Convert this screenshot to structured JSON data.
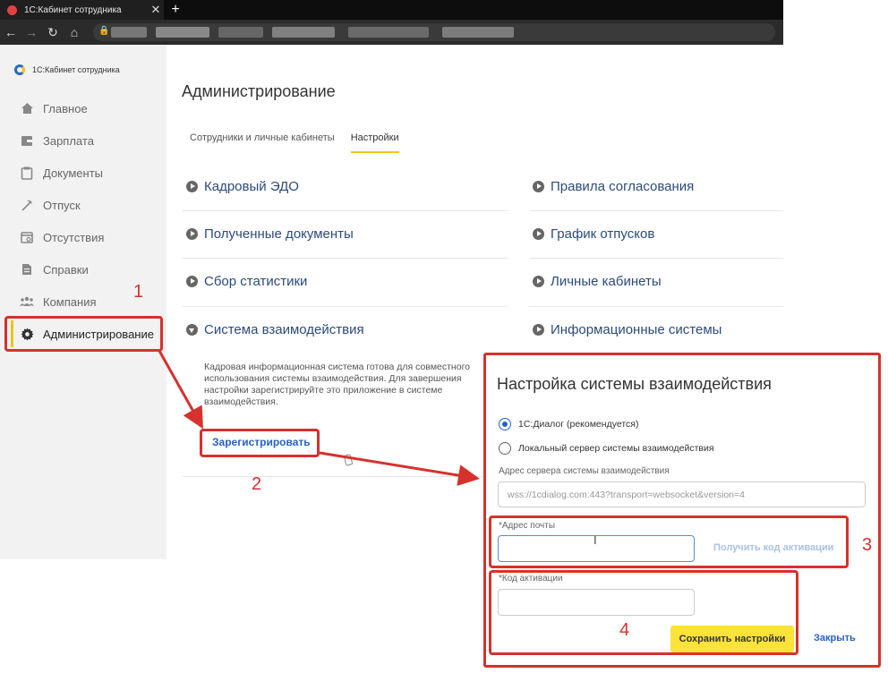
{
  "browser": {
    "tab_title": "1С:Кабинет сотрудника",
    "tab_close": "✕",
    "new_tab": "+"
  },
  "app": {
    "logo_text": "1С:Кабинет сотрудника"
  },
  "sidebar": {
    "items": [
      {
        "label": "Главное",
        "icon": "home-icon"
      },
      {
        "label": "Зарплата",
        "icon": "wallet-icon"
      },
      {
        "label": "Документы",
        "icon": "documents-icon"
      },
      {
        "label": "Отпуск",
        "icon": "vacation-icon"
      },
      {
        "label": "Отсутствия",
        "icon": "calendar-icon"
      },
      {
        "label": "Справки",
        "icon": "certificate-icon"
      },
      {
        "label": "Компания",
        "icon": "people-icon"
      },
      {
        "label": "Администрирование",
        "icon": "gear-icon",
        "active": true
      }
    ]
  },
  "page": {
    "title": "Администрирование",
    "tabs": [
      {
        "label": "Сотрудники и личные кабинеты"
      },
      {
        "label": "Настройки",
        "selected": true
      }
    ],
    "sections_left": [
      {
        "label": "Кадровый ЭДО"
      },
      {
        "label": "Полученные документы"
      },
      {
        "label": "Сбор статистики"
      },
      {
        "label": "Система взаимодействия",
        "expanded": true
      }
    ],
    "sections_right": [
      {
        "label": "Правила согласования"
      },
      {
        "label": "График отпусков"
      },
      {
        "label": "Личные кабинеты"
      },
      {
        "label": "Информационные системы"
      }
    ],
    "interaction_description": "Кадровая информационная система готова для совместного использования системы взаимодействия. Для завершения настройки зарегистрируйте это приложение в системе взаимодействия.",
    "register_link": "Зарегистрировать"
  },
  "annotations": {
    "n1": "1",
    "n2": "2",
    "n3": "3",
    "n4": "4",
    "color": "#d6312c"
  },
  "dialog": {
    "title": "Настройка системы взаимодействия",
    "radio_options": [
      {
        "label": "1С:Диалог (рекомендуется)",
        "checked": true
      },
      {
        "label": "Локальный сервер системы взаимодействия",
        "checked": false
      }
    ],
    "server_label": "Адрес сервера системы взаимодействия",
    "server_value": "wss://1cdialog.com:443?transport=websocket&version=4",
    "email_label": "*Адрес почты",
    "email_value": "",
    "get_code_button": "Получить код активации",
    "code_label": "*Код активации",
    "code_value": "",
    "save_button": "Сохранить настройки",
    "close_button": "Закрыть"
  },
  "colors": {
    "accent": "#f0c419",
    "link": "#2561c6",
    "annotation": "#d6312c"
  }
}
